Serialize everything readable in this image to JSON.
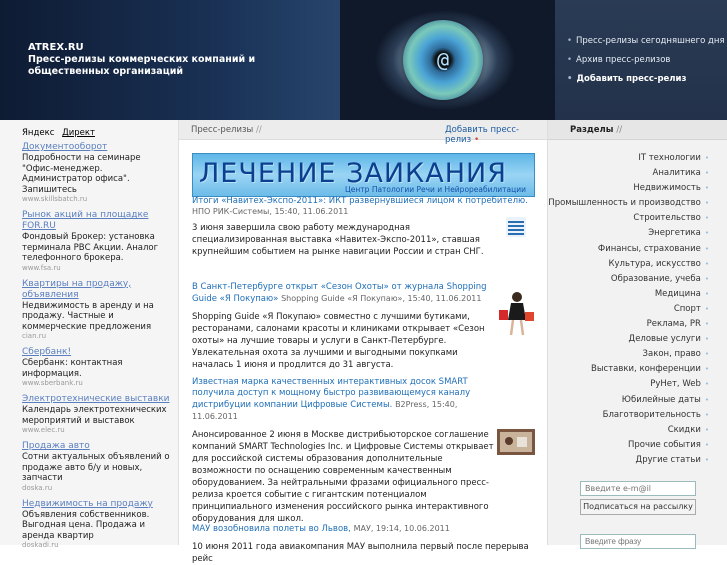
{
  "header": {
    "site_name": "ATREX.RU",
    "slogan": "Пресс-релизы коммерческих компаний и общественных организаций",
    "menu": [
      {
        "label": "Пресс-релизы сегодняшнего дня",
        "bold": false
      },
      {
        "label": "Архив пресс-релизов",
        "bold": false
      },
      {
        "label": "Добавить пресс-релиз",
        "bold": true
      }
    ]
  },
  "left": {
    "yandex_label": "Яндекс",
    "direct_label": "Директ",
    "ads": [
      {
        "title": "Документооборот",
        "text": "Подробности на семинаре \"Офис-менеджер. Администратор офиса\". Запишитесь",
        "url": "www.skillsbatch.ru"
      },
      {
        "title": "Рынок акций на площадке FOR.RU",
        "text": "Фондовый Брокер: установка терминала РВС Акции. Аналог телефонного брокера.",
        "url": "www.fsa.ru"
      },
      {
        "title": "Квартиры на продажу, объявления",
        "text": "Недвижимость в аренду и на продажу. Частные и коммерческие предложения",
        "url": "cian.ru"
      },
      {
        "title": "Сбербанк!",
        "text": "Сбербанк: контактная информация.",
        "url": "www.sberbank.ru"
      },
      {
        "title": "Электротехнические выставки",
        "text": "Календарь электротехнических мероприятий и выставок",
        "url": "www.elec.ru"
      },
      {
        "title": "Продажа авто",
        "text": "Сотни актуальных объявлений о продаже авто б/у и новых, запчасти",
        "url": "doska.ru"
      },
      {
        "title": "Недвижимость на продажу",
        "text": "Объявления собственников. Выгодная цена. Продажа и аренда квартир",
        "url": "doskadi.ru"
      }
    ]
  },
  "main": {
    "breadcrumb": "Пресс-релизы",
    "breadcrumb_sep": "//",
    "add_label": "Добавить пресс-релиз",
    "banner": {
      "title": "ЛЕЧЕНИЕ ЗАИКАНИЯ",
      "subtitle": "Центр Патологии Речи и Нейрореабилитации"
    },
    "news": [
      {
        "title": "Итоги «Навитех-Экспо-2011»: ИКТ развернувшиеся лицом к потребителю.",
        "meta": "НПО РИК-Системы, 15:40, 11.06.2011",
        "body": "3 июня завершила свою работу международная специализированная выставка «Навитех-Экспо-2011», ставшая крупнейшим событием на рынке навигации России и стран СНГ."
      },
      {
        "title": "В Санкт-Петербурге открыт «Сезон Охоты» от журнала Shopping Guide «Я Покупаю»",
        "meta": "Shopping Guide «Я Покупаю», 15:40, 11.06.2011",
        "body": "Shopping Guide «Я Покупаю» совместно с лучшими бутиками, ресторанами, салонами красоты и клиниками открывает «Сезон охоты» на лучшие товары и услуги в Санкт-Петербурге. Увлекательная охота за лучшими и выгодными покупками началась 1 июня и продлится до 31 августа."
      },
      {
        "title": "Известная марка качественных интерактивных досок SMART получила доступ к мощному быстро развивающемуся каналу дистрибуции компании Цифровые Системы.",
        "meta": "B2Press, 15:40, 11.06.2011",
        "body": "Анонсированное 2 июня в Москве дистрибьюторское соглашение компаний SMART Technologies Inc. и Цифровые Системы открывает для российской системы образования дополнительные возможности по оснащению современным качественным оборудованием. За нейтральными фразами официального пресс-релиза кроется событие с гигантским потенциалом принципиального изменения российского рынка интерактивного оборудования для школ."
      },
      {
        "title": "МАУ возобновила полеты во Львов",
        "meta": "МАУ, 19:14, 10.06.2011",
        "body": "10 июня 2011 года авиакомпания МАУ выполнила первый после перерыва рейс"
      }
    ]
  },
  "right": {
    "title": "Разделы",
    "title_sep": "//",
    "categories": [
      "IT технологии",
      "Аналитика",
      "Недвижимость",
      "Промышленность и производство",
      "Строительство",
      "Энергетика",
      "Финансы, страхование",
      "Культура, искусство",
      "Образование, учеба",
      "Медицина",
      "Спорт",
      "Реклама, PR",
      "Деловые услуги",
      "Закон, право",
      "Выставки, конференции",
      "РуНет, Web",
      "Юбилейные даты",
      "Благотворительность",
      "Скидки",
      "Прочие события",
      "Другие статьи"
    ],
    "email_placeholder": "Введите e-m@il",
    "subscribe_label": "Подписаться на рассылку",
    "search_placeholder": "Введите фразу"
  }
}
